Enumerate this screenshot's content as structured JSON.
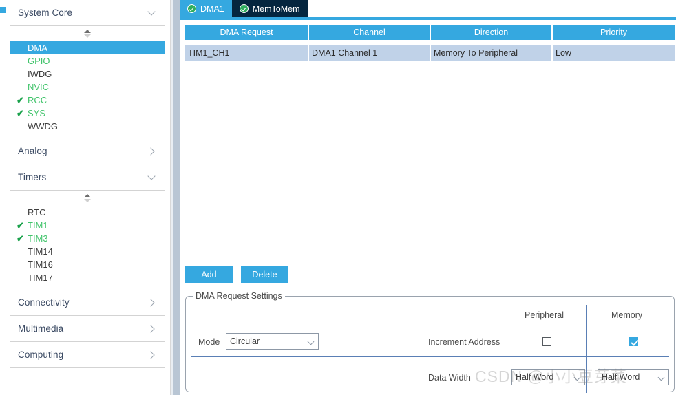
{
  "sidebar": {
    "sections": [
      {
        "label": "System Core",
        "expanded": true,
        "chevron": "chevron-down-icon",
        "items": [
          {
            "label": "DMA",
            "state": "selected"
          },
          {
            "label": "GPIO",
            "state": "enabled"
          },
          {
            "label": "IWDG",
            "state": "normal"
          },
          {
            "label": "NVIC",
            "state": "enabled"
          },
          {
            "label": "RCC",
            "state": "checked"
          },
          {
            "label": "SYS",
            "state": "checked"
          },
          {
            "label": "WWDG",
            "state": "normal"
          }
        ]
      },
      {
        "label": "Analog",
        "expanded": false,
        "chevron": "chevron-right-icon",
        "items": []
      },
      {
        "label": "Timers",
        "expanded": true,
        "chevron": "chevron-down-icon",
        "items": [
          {
            "label": "RTC",
            "state": "normal"
          },
          {
            "label": "TIM1",
            "state": "checked"
          },
          {
            "label": "TIM3",
            "state": "checked"
          },
          {
            "label": "TIM14",
            "state": "normal"
          },
          {
            "label": "TIM16",
            "state": "normal"
          },
          {
            "label": "TIM17",
            "state": "normal"
          }
        ]
      },
      {
        "label": "Connectivity",
        "expanded": false,
        "chevron": "chevron-right-icon",
        "items": []
      },
      {
        "label": "Multimedia",
        "expanded": false,
        "chevron": "chevron-right-icon",
        "items": []
      },
      {
        "label": "Computing",
        "expanded": false,
        "chevron": "chevron-right-icon",
        "items": []
      }
    ]
  },
  "tabs": [
    {
      "label": "DMA1",
      "active": true,
      "icon": "check-circle-icon"
    },
    {
      "label": "MemToMem",
      "active": false,
      "icon": "check-circle-icon"
    }
  ],
  "table": {
    "columns": [
      "DMA Request",
      "Channel",
      "Direction",
      "Priority"
    ],
    "rows": [
      [
        "TIM1_CH1",
        "DMA1 Channel 1",
        "Memory To Peripheral",
        "Low"
      ]
    ]
  },
  "buttons": {
    "add": "Add",
    "delete": "Delete"
  },
  "settings": {
    "legend": "DMA Request Settings",
    "column_headers": {
      "peripheral": "Peripheral",
      "memory": "Memory"
    },
    "mode": {
      "label": "Mode",
      "value": "Circular"
    },
    "increment_address": {
      "label": "Increment Address",
      "peripheral_checked": false,
      "memory_checked": true
    },
    "data_width": {
      "label": "Data Width",
      "peripheral_value": "Half Word",
      "memory_value": "Half Word"
    }
  },
  "watermark": "CSDN @小小豆芽菜",
  "colors": {
    "accent_blue": "#35a8e0",
    "tab_inactive": "#05263f",
    "row_selected": "#c0d2e8",
    "enabled_green": "#41c46b",
    "check_green": "#1aa14b"
  }
}
